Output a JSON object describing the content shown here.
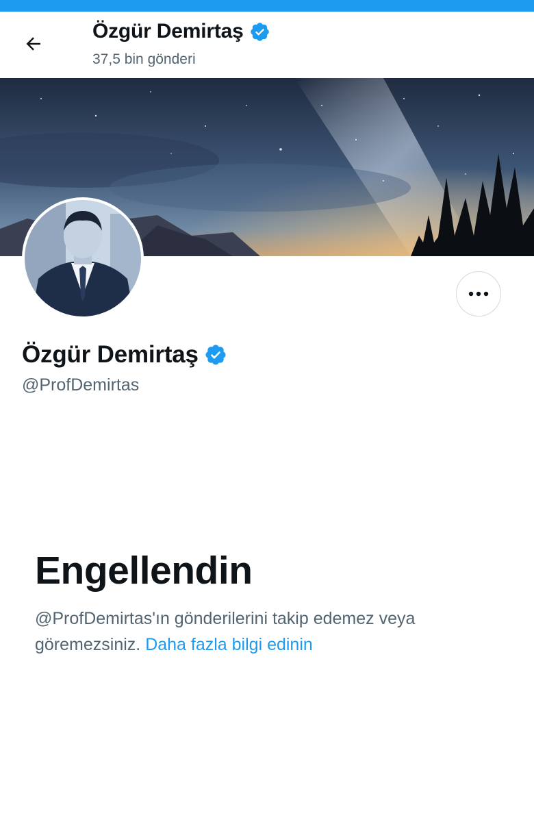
{
  "header": {
    "name": "Özgür Demirtaş",
    "post_count": "37,5 bin gönderi"
  },
  "profile": {
    "name": "Özgür Demirtaş",
    "handle": "@ProfDemirtas"
  },
  "blocked": {
    "title": "Engellendin",
    "message": "@ProfDemirtas'ın gönderilerini takip edemez veya göremezsiniz.",
    "link_text": "Daha fazla bilgi edinin"
  },
  "colors": {
    "accent": "#1d9bf0",
    "text_primary": "#0f1419",
    "text_secondary": "#536471",
    "border": "#cfd9de"
  },
  "icons": {
    "back": "arrow-left-icon",
    "verified": "verified-badge-icon",
    "more": "more-horizontal-icon"
  }
}
